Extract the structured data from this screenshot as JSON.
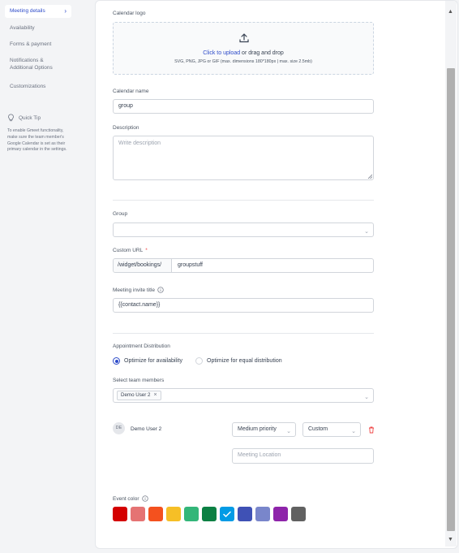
{
  "sidebar": {
    "items": [
      {
        "label": "Meeting details",
        "active": true
      },
      {
        "label": "Availability"
      },
      {
        "label": "Forms & payment"
      },
      {
        "label": "Notifications & Additional Options"
      },
      {
        "label": "Customizations"
      }
    ],
    "tip_title": "Quick Tip",
    "tip_body": "To enable Gmeet functionality, make sure the team member's Google Calendar is set as their primary calendar in the settings."
  },
  "form": {
    "calendar_logo_label": "Calendar logo",
    "upload_link": "Click to upload",
    "upload_rest": " or drag and drop",
    "upload_hint": "SVG, PNG, JPG or GIF (max. dimensions 180*180px | max. size 2.5mb)",
    "calendar_name_label": "Calendar name",
    "calendar_name_value": "group",
    "description_label": "Description",
    "description_placeholder": "Write description",
    "group_label": "Group",
    "custom_url_label": "Custom URL",
    "required_mark": "*",
    "url_prefix": "/widget/bookings/",
    "url_value": "groupstuff",
    "invite_title_label": "Meeting invite title",
    "invite_title_value": "{{contact.name}}",
    "distribution_label": "Appointment Distribution",
    "option_availability": "Optimize for availability",
    "option_equal": "Optimize for equal distribution",
    "team_label": "Select team members",
    "team_chip": "Demo User 2",
    "member_initials": "DE",
    "member_name": "Demo User 2",
    "priority_value": "Medium priority",
    "custom_value": "Custom",
    "location_placeholder": "Meeting Location",
    "event_color_label": "Event color"
  },
  "colors": {
    "accent": "#2d4bc9",
    "swatches": [
      "#d40000",
      "#e57373",
      "#f4511e",
      "#f6bf26",
      "#33b679",
      "#0b8043",
      "#039be5",
      "#3f51b5",
      "#7986cb",
      "#8e24aa",
      "#616161"
    ],
    "selected_swatch_index": 6
  }
}
